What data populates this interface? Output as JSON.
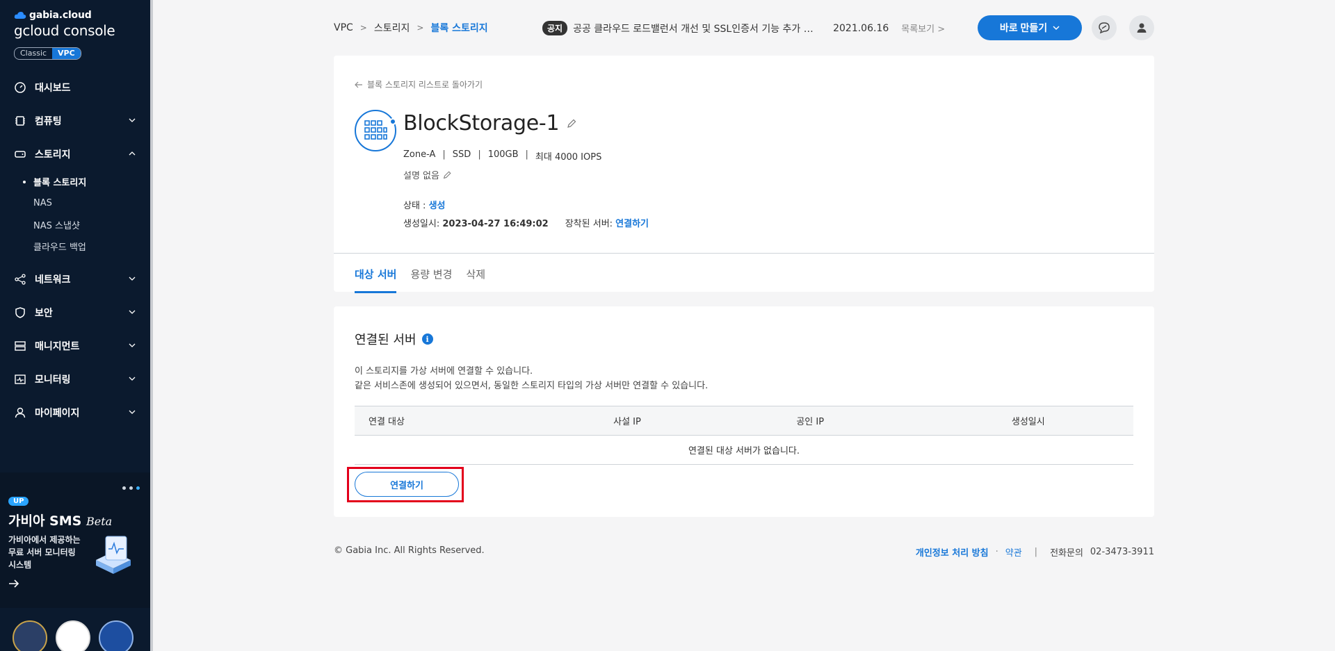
{
  "brand": {
    "top": "gabia.cloud",
    "sub": "gcloud console"
  },
  "mode": {
    "classic": "Classic",
    "vpc": "VPC"
  },
  "nav": {
    "dashboard": "대시보드",
    "computing": "컴퓨팅",
    "storage": "스토리지",
    "storage_sub": [
      "블록 스토리지",
      "NAS",
      "NAS 스냅샷",
      "클라우드 백업"
    ],
    "network": "네트워크",
    "security": "보안",
    "management": "매니지먼트",
    "monitoring": "모니터링",
    "mypage": "마이페이지"
  },
  "promo": {
    "badge": "UP",
    "title": "가비아 SMS",
    "title_em": "Beta",
    "desc": "가비아에서 제공하는 무료 서버 모니터링 시스템"
  },
  "breadcrumb": {
    "a": "VPC",
    "b": "스토리지",
    "c": "블록 스토리지"
  },
  "notice": {
    "tag": "공지",
    "text": "공공 클라우드 로드밸런서 개선 및 SSL인증서 기능 추가 안내",
    "date": "2021.06.16",
    "more": "목록보기"
  },
  "make_button": "바로 만들기",
  "detail": {
    "back": "블록 스토리지 리스트로 돌아가기",
    "name": "BlockStorage-1",
    "zone": "Zone-A",
    "type": "SSD",
    "size": "100GB",
    "iops": "최대 4000 IOPS",
    "description": "설명 없음",
    "status_label": "상태 : ",
    "status_value": "생성",
    "created_label": "생성일시: ",
    "created_value": "2023-04-27 16:49:02",
    "mounted_label": "장착된 서버: ",
    "mounted_value": "연결하기"
  },
  "tabs": [
    "대상 서버",
    "용량 변경",
    "삭제"
  ],
  "connected": {
    "title": "연결된 서버",
    "help1": "이 스토리지를 가상 서버에 연결할 수 있습니다.",
    "help2": "같은 서비스존에 생성되어 있으면서, 동일한 스토리지 타입의 가상 서버만 연결할 수 있습니다.",
    "columns": [
      "연결 대상",
      "사설 IP",
      "공인 IP",
      "생성일시"
    ],
    "empty": "연결된 대상 서버가 없습니다.",
    "connect_button": "연결하기"
  },
  "footer": {
    "copyright": "© Gabia Inc. All Rights Reserved.",
    "privacy": "개인정보 처리 방침",
    "terms": "약관",
    "phone_label": "전화문의",
    "phone": "02-3473-3911"
  }
}
